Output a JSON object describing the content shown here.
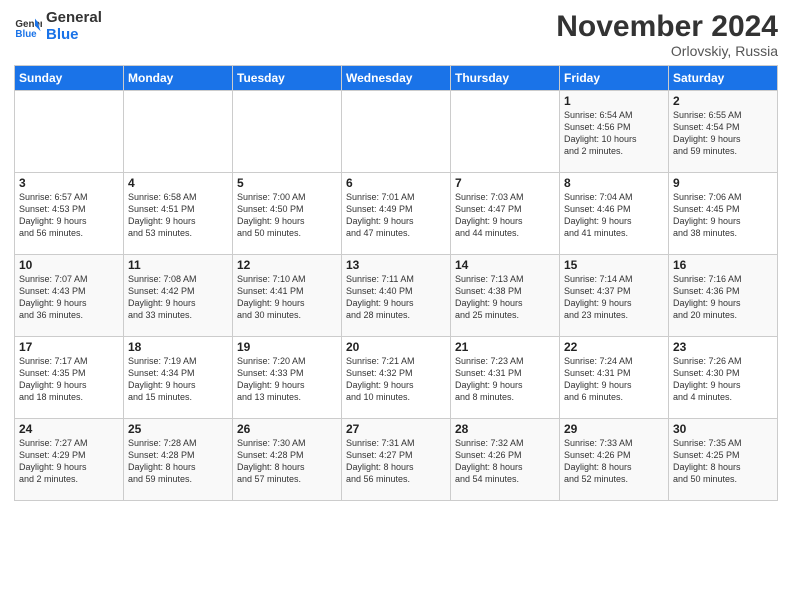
{
  "logo": {
    "line1": "General",
    "line2": "Blue"
  },
  "title": "November 2024",
  "location": "Orlovskiy, Russia",
  "days_of_week": [
    "Sunday",
    "Monday",
    "Tuesday",
    "Wednesday",
    "Thursday",
    "Friday",
    "Saturday"
  ],
  "weeks": [
    [
      {
        "day": "",
        "info": ""
      },
      {
        "day": "",
        "info": ""
      },
      {
        "day": "",
        "info": ""
      },
      {
        "day": "",
        "info": ""
      },
      {
        "day": "",
        "info": ""
      },
      {
        "day": "1",
        "info": "Sunrise: 6:54 AM\nSunset: 4:56 PM\nDaylight: 10 hours\nand 2 minutes."
      },
      {
        "day": "2",
        "info": "Sunrise: 6:55 AM\nSunset: 4:54 PM\nDaylight: 9 hours\nand 59 minutes."
      }
    ],
    [
      {
        "day": "3",
        "info": "Sunrise: 6:57 AM\nSunset: 4:53 PM\nDaylight: 9 hours\nand 56 minutes."
      },
      {
        "day": "4",
        "info": "Sunrise: 6:58 AM\nSunset: 4:51 PM\nDaylight: 9 hours\nand 53 minutes."
      },
      {
        "day": "5",
        "info": "Sunrise: 7:00 AM\nSunset: 4:50 PM\nDaylight: 9 hours\nand 50 minutes."
      },
      {
        "day": "6",
        "info": "Sunrise: 7:01 AM\nSunset: 4:49 PM\nDaylight: 9 hours\nand 47 minutes."
      },
      {
        "day": "7",
        "info": "Sunrise: 7:03 AM\nSunset: 4:47 PM\nDaylight: 9 hours\nand 44 minutes."
      },
      {
        "day": "8",
        "info": "Sunrise: 7:04 AM\nSunset: 4:46 PM\nDaylight: 9 hours\nand 41 minutes."
      },
      {
        "day": "9",
        "info": "Sunrise: 7:06 AM\nSunset: 4:45 PM\nDaylight: 9 hours\nand 38 minutes."
      }
    ],
    [
      {
        "day": "10",
        "info": "Sunrise: 7:07 AM\nSunset: 4:43 PM\nDaylight: 9 hours\nand 36 minutes."
      },
      {
        "day": "11",
        "info": "Sunrise: 7:08 AM\nSunset: 4:42 PM\nDaylight: 9 hours\nand 33 minutes."
      },
      {
        "day": "12",
        "info": "Sunrise: 7:10 AM\nSunset: 4:41 PM\nDaylight: 9 hours\nand 30 minutes."
      },
      {
        "day": "13",
        "info": "Sunrise: 7:11 AM\nSunset: 4:40 PM\nDaylight: 9 hours\nand 28 minutes."
      },
      {
        "day": "14",
        "info": "Sunrise: 7:13 AM\nSunset: 4:38 PM\nDaylight: 9 hours\nand 25 minutes."
      },
      {
        "day": "15",
        "info": "Sunrise: 7:14 AM\nSunset: 4:37 PM\nDaylight: 9 hours\nand 23 minutes."
      },
      {
        "day": "16",
        "info": "Sunrise: 7:16 AM\nSunset: 4:36 PM\nDaylight: 9 hours\nand 20 minutes."
      }
    ],
    [
      {
        "day": "17",
        "info": "Sunrise: 7:17 AM\nSunset: 4:35 PM\nDaylight: 9 hours\nand 18 minutes."
      },
      {
        "day": "18",
        "info": "Sunrise: 7:19 AM\nSunset: 4:34 PM\nDaylight: 9 hours\nand 15 minutes."
      },
      {
        "day": "19",
        "info": "Sunrise: 7:20 AM\nSunset: 4:33 PM\nDaylight: 9 hours\nand 13 minutes."
      },
      {
        "day": "20",
        "info": "Sunrise: 7:21 AM\nSunset: 4:32 PM\nDaylight: 9 hours\nand 10 minutes."
      },
      {
        "day": "21",
        "info": "Sunrise: 7:23 AM\nSunset: 4:31 PM\nDaylight: 9 hours\nand 8 minutes."
      },
      {
        "day": "22",
        "info": "Sunrise: 7:24 AM\nSunset: 4:31 PM\nDaylight: 9 hours\nand 6 minutes."
      },
      {
        "day": "23",
        "info": "Sunrise: 7:26 AM\nSunset: 4:30 PM\nDaylight: 9 hours\nand 4 minutes."
      }
    ],
    [
      {
        "day": "24",
        "info": "Sunrise: 7:27 AM\nSunset: 4:29 PM\nDaylight: 9 hours\nand 2 minutes."
      },
      {
        "day": "25",
        "info": "Sunrise: 7:28 AM\nSunset: 4:28 PM\nDaylight: 8 hours\nand 59 minutes."
      },
      {
        "day": "26",
        "info": "Sunrise: 7:30 AM\nSunset: 4:28 PM\nDaylight: 8 hours\nand 57 minutes."
      },
      {
        "day": "27",
        "info": "Sunrise: 7:31 AM\nSunset: 4:27 PM\nDaylight: 8 hours\nand 56 minutes."
      },
      {
        "day": "28",
        "info": "Sunrise: 7:32 AM\nSunset: 4:26 PM\nDaylight: 8 hours\nand 54 minutes."
      },
      {
        "day": "29",
        "info": "Sunrise: 7:33 AM\nSunset: 4:26 PM\nDaylight: 8 hours\nand 52 minutes."
      },
      {
        "day": "30",
        "info": "Sunrise: 7:35 AM\nSunset: 4:25 PM\nDaylight: 8 hours\nand 50 minutes."
      }
    ]
  ]
}
